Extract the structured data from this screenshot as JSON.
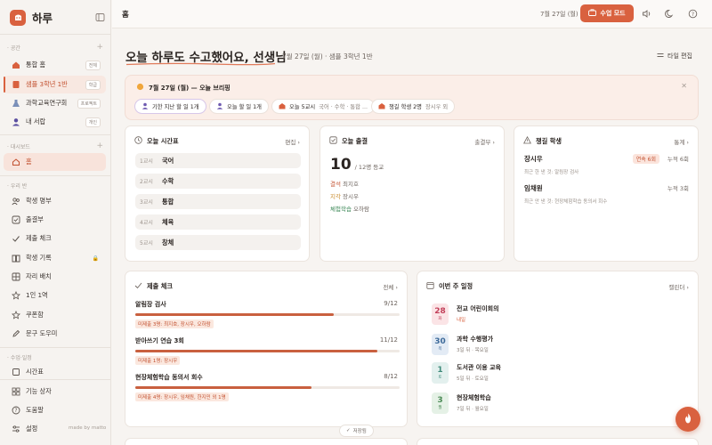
{
  "app": {
    "name": "하루",
    "made_by": "made by matto"
  },
  "sidebar": {
    "space_label": "공간",
    "spaces": [
      {
        "label": "통합 홈",
        "badge": "전체"
      },
      {
        "label": "샘플 3학년 1반",
        "badge": "학급"
      },
      {
        "label": "과학교육연구회",
        "badge": "프로젝트"
      },
      {
        "label": "내 서랍",
        "badge": "개인"
      }
    ],
    "dashboard_label": "대시보드",
    "home_label": "홈",
    "ourclass_label": "우리 반",
    "class_items": [
      {
        "label": "학생 명부",
        "icon": "users-icon"
      },
      {
        "label": "출결부",
        "icon": "checkbox-icon"
      },
      {
        "label": "제출 체크",
        "icon": "check-icon"
      },
      {
        "label": "학생 기록",
        "icon": "book-icon"
      },
      {
        "label": "자리 배치",
        "icon": "grid-icon"
      },
      {
        "label": "1인 1역",
        "icon": "star-icon"
      },
      {
        "label": "쿠폰함",
        "icon": "star-icon"
      },
      {
        "label": "문구 도우미",
        "icon": "pen-icon"
      }
    ],
    "class_section_label": "수업·일정",
    "timetable_label": "시간표",
    "footer_items": [
      {
        "label": "기능 상자"
      },
      {
        "label": "도움말"
      },
      {
        "label": "설정"
      }
    ]
  },
  "topbar": {
    "title": "홈",
    "date": "7월 27일 (월)",
    "mode_button": "수업 모드"
  },
  "greeting": {
    "title": "오늘 하루도 수고했어요, 선생님",
    "subtitle": "7월 27일 (월) · 샘플 3학년 1반",
    "layout_edit": "타일 편집"
  },
  "briefing": {
    "title": "7월 27일 (월) — 오늘 브리핑",
    "chips": [
      {
        "main": "기한 지난 할 일 1개",
        "sub": ""
      },
      {
        "main": "오늘 할 일 1개",
        "sub": ""
      },
      {
        "main": "오늘 5교시",
        "sub": "국어 · 수학 · 통합 ..."
      },
      {
        "main": "챙길 학생 2명",
        "sub": "장시우 외"
      }
    ]
  },
  "timetable": {
    "title": "오늘 시간표",
    "link": "편집",
    "periods": [
      {
        "no": "1교시",
        "subject": "국어"
      },
      {
        "no": "2교시",
        "subject": "수학"
      },
      {
        "no": "3교시",
        "subject": "통합"
      },
      {
        "no": "4교시",
        "subject": "체육"
      },
      {
        "no": "5교시",
        "subject": "창체"
      }
    ]
  },
  "attendance": {
    "title": "오늘 출결",
    "link": "출결부",
    "present": "10",
    "total_text": "/ 12명 등교",
    "lines": [
      {
        "type": "결석",
        "name": "최지호",
        "color": "#c2502f"
      },
      {
        "type": "지각",
        "name": "장시우",
        "color": "#c98a2a"
      },
      {
        "type": "체험학습",
        "name": "오하람",
        "color": "#3f8a5a"
      }
    ]
  },
  "watch": {
    "title": "챙길 학생",
    "link": "통계",
    "students": [
      {
        "name": "장시우",
        "streak": "연속 6회",
        "count": "누적 6회",
        "note": "최근 한 낸 것: 알림장 검사"
      },
      {
        "name": "임채원",
        "streak": "",
        "count": "누적 3회",
        "note": "최근 안 낸 것: 현장체험학습 동의서 회수"
      }
    ]
  },
  "submissions": {
    "title": "제출 체크",
    "link": "전체",
    "items": [
      {
        "name": "알림장 검사",
        "count": "9/12",
        "ratio": 0.75,
        "missing": "미제출 3명: 최지호, 장시우, 오하람"
      },
      {
        "name": "받아쓰기 연습 3회",
        "count": "11/12",
        "ratio": 0.917,
        "missing": "미제출 1명: 장시우"
      },
      {
        "name": "현장체험학습 동의서 회수",
        "count": "8/12",
        "ratio": 0.667,
        "missing": "미제출 4명: 장시우, 임채원, 한지민 외 1명"
      }
    ]
  },
  "events": {
    "title": "이번 주 일정",
    "link": "캘린더",
    "items": [
      {
        "day": "28",
        "dow": "화",
        "title": "전교 어린이회의",
        "sub": "내일",
        "bg": "#fbe4e6",
        "fg": "#c2405a"
      },
      {
        "day": "30",
        "dow": "목",
        "title": "과학 수행평가",
        "sub": "3일 뒤 · 목요일",
        "bg": "#e3ebf5",
        "fg": "#3d6a9a"
      },
      {
        "day": "1",
        "dow": "토",
        "title": "도서관 이용 교육",
        "sub": "5일 뒤 · 토요일",
        "bg": "#e3f0ee",
        "fg": "#3f8a7a"
      },
      {
        "day": "3",
        "dow": "월",
        "title": "현장체험학습",
        "sub": "7일 뒤 · 월요일",
        "bg": "#e5f1e6",
        "fg": "#4a8a55"
      }
    ]
  },
  "saved_label": "저장됨",
  "colors": {
    "accent": "#d9613f",
    "active_bg": "#f8e3db"
  }
}
